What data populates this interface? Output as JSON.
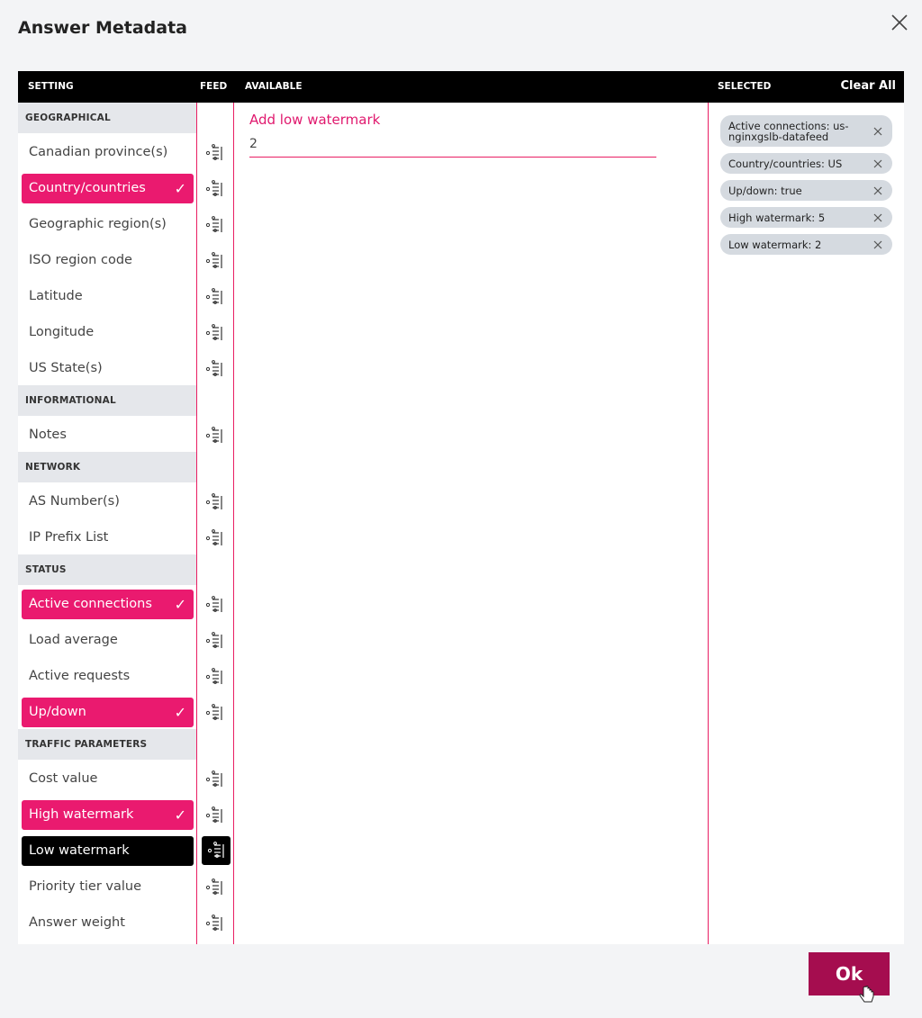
{
  "dialog": {
    "title": "Answer Metadata"
  },
  "columns": {
    "setting": "SETTING",
    "feed": "FEED",
    "available": "AVAILABLE",
    "selected": "SELECTED",
    "clear_all": "Clear All"
  },
  "sections": [
    {
      "header": "GEOGRAPHICAL",
      "items": [
        {
          "label": "Canadian province(s)",
          "state": "normal"
        },
        {
          "label": "Country/countries",
          "state": "selected"
        },
        {
          "label": "Geographic region(s)",
          "state": "normal"
        },
        {
          "label": "ISO region code",
          "state": "normal"
        },
        {
          "label": "Latitude",
          "state": "normal"
        },
        {
          "label": "Longitude",
          "state": "normal"
        },
        {
          "label": "US State(s)",
          "state": "normal"
        }
      ]
    },
    {
      "header": "INFORMATIONAL",
      "items": [
        {
          "label": "Notes",
          "state": "normal"
        }
      ]
    },
    {
      "header": "NETWORK",
      "items": [
        {
          "label": "AS Number(s)",
          "state": "normal"
        },
        {
          "label": "IP Prefix List",
          "state": "normal"
        }
      ]
    },
    {
      "header": "STATUS",
      "items": [
        {
          "label": "Active connections",
          "state": "selected"
        },
        {
          "label": "Load average",
          "state": "normal"
        },
        {
          "label": "Active requests",
          "state": "normal"
        },
        {
          "label": "Up/down",
          "state": "selected"
        }
      ]
    },
    {
      "header": "TRAFFIC PARAMETERS",
      "items": [
        {
          "label": "Cost value",
          "state": "normal"
        },
        {
          "label": "High watermark",
          "state": "selected"
        },
        {
          "label": "Low watermark",
          "state": "active"
        },
        {
          "label": "Priority tier value",
          "state": "normal"
        },
        {
          "label": "Answer weight",
          "state": "normal"
        }
      ]
    }
  ],
  "check_mark": "✓",
  "available": {
    "label": "Add low watermark",
    "value": "2"
  },
  "selected_chips": [
    {
      "text": "Active connections:  us-nginxgslb-datafeed"
    },
    {
      "text": "Country/countries:  US"
    },
    {
      "text": "Up/down:  true"
    },
    {
      "text": "High watermark:  5"
    },
    {
      "text": "Low watermark:  2"
    }
  ],
  "ok_button": "Ok",
  "icons": {
    "close": "close-icon",
    "feed": "feed-filter-icon",
    "chip_remove": "remove-icon",
    "cursor": "hand-cursor-icon"
  },
  "colors": {
    "accent": "#ea1a6f",
    "active": "#000000",
    "ok": "#a50d4f",
    "header_bg": "#000000"
  }
}
